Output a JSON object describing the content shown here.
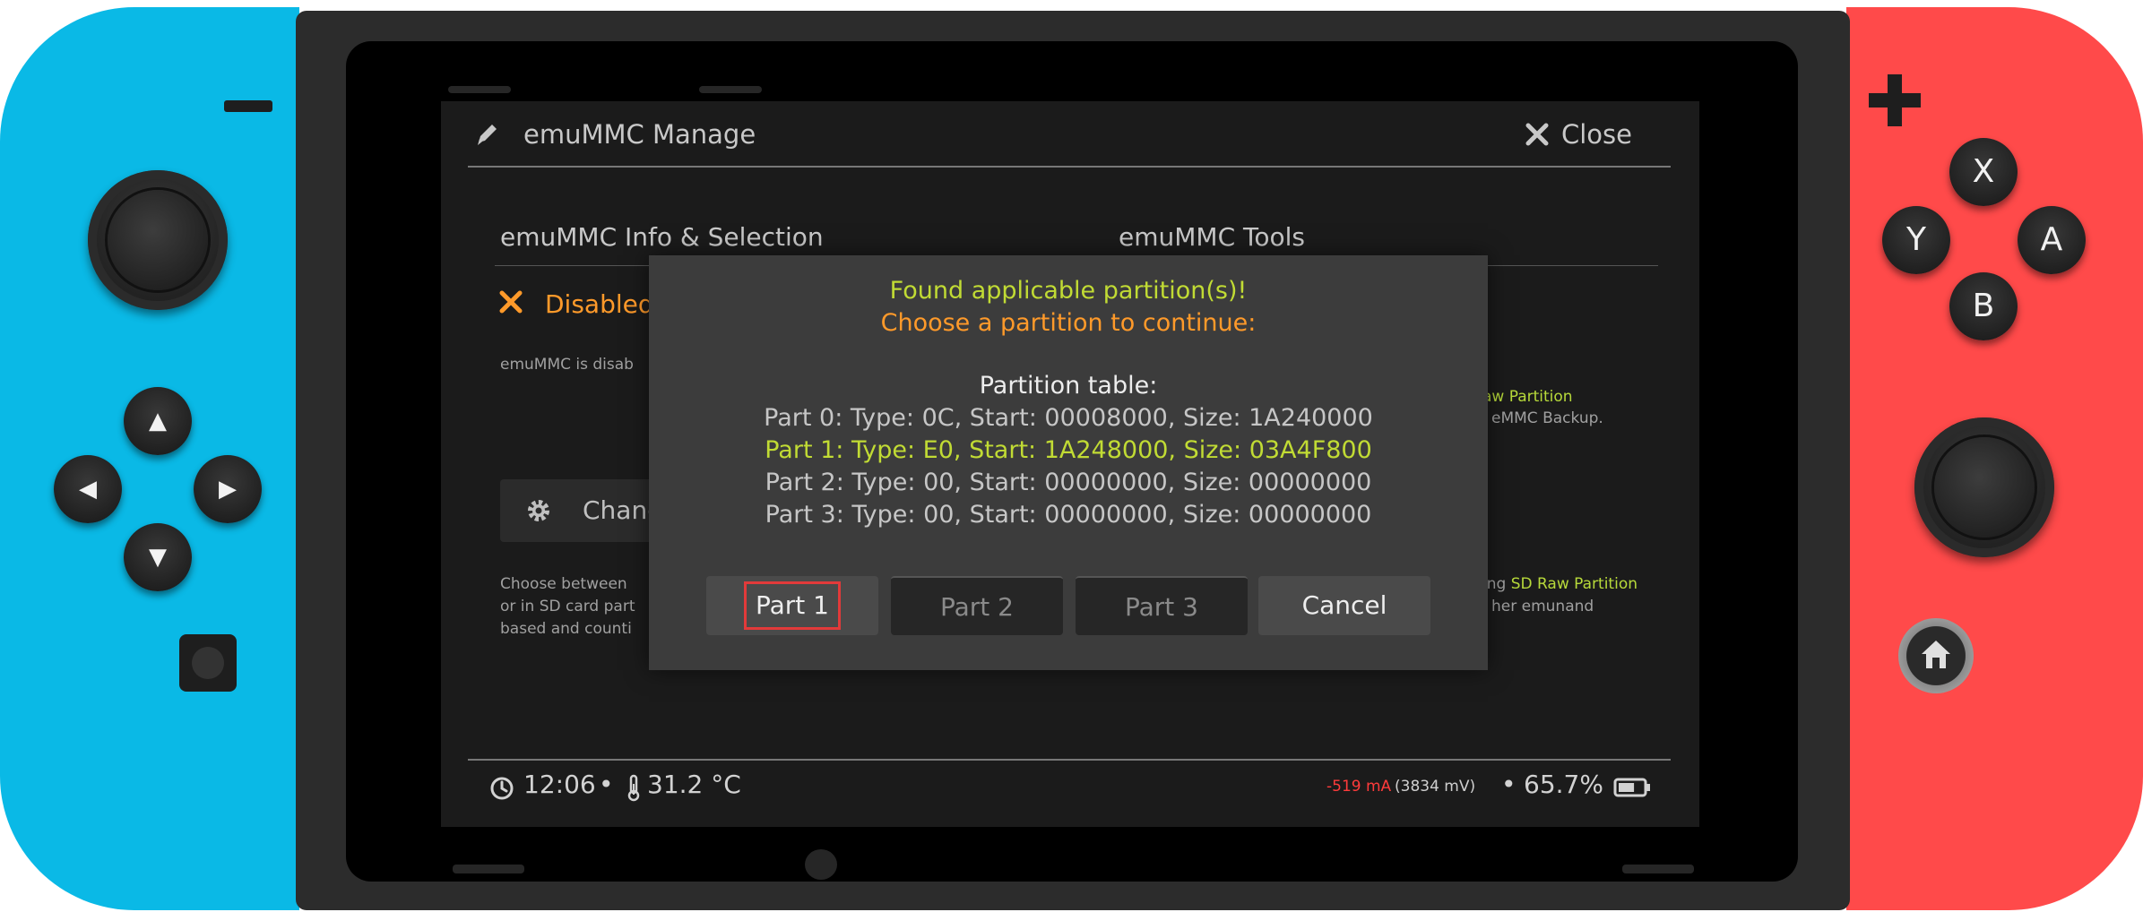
{
  "app": {
    "title": "emuMMC Manage",
    "close_label": "Close"
  },
  "left_panel": {
    "title": "emuMMC Info & Selection",
    "status": "Disabled",
    "description": "emuMMC is disab",
    "change_button": "Chang",
    "help_lines": [
      "Choose between",
      "or in SD card part",
      "based and counti"
    ]
  },
  "right_panel": {
    "title": "emuMMC Tools",
    "line1_link": "aw Partition",
    "line2": "eMMC Backup.",
    "line3_prefix": "ing ",
    "line3_link": "SD Raw Partition",
    "line4": "her emunand"
  },
  "dialog": {
    "found": "Found applicable partition(s)!",
    "choose": "Choose a partition to continue:",
    "table_title": "Partition table:",
    "rows": [
      "Part 0: Type: 0C, Start: 00008000, Size: 1A240000",
      "Part 1: Type: E0, Start: 1A248000, Size: 03A4F800",
      "Part 2: Type: 00, Start: 00000000, Size: 00000000",
      "Part 3: Type: 00, Start: 00000000, Size: 00000000"
    ],
    "buttons": [
      "Part 1",
      "Part 2",
      "Part 3",
      "Cancel"
    ],
    "selected_row": 1,
    "focused_button": "Part 1"
  },
  "status_bar": {
    "time": "12:06",
    "separator": "•",
    "temperature": "31.2 °C",
    "current": "-519 mA",
    "voltage": "(3834 mV)",
    "battery_percent": "65.7%",
    "battery_level": 0.657
  },
  "controller": {
    "left_buttons": [
      "dpad-up",
      "dpad-left",
      "dpad-right",
      "dpad-down"
    ],
    "right_buttons": [
      "X",
      "Y",
      "A",
      "B"
    ]
  },
  "colors": {
    "left_joycon": "#0ab9e6",
    "right_joycon": "#ff4a4a",
    "accent_green": "#c1db34",
    "accent_orange": "#ff9a2a",
    "focus_red": "#e23a3a",
    "current_red": "#ff3b3b"
  }
}
